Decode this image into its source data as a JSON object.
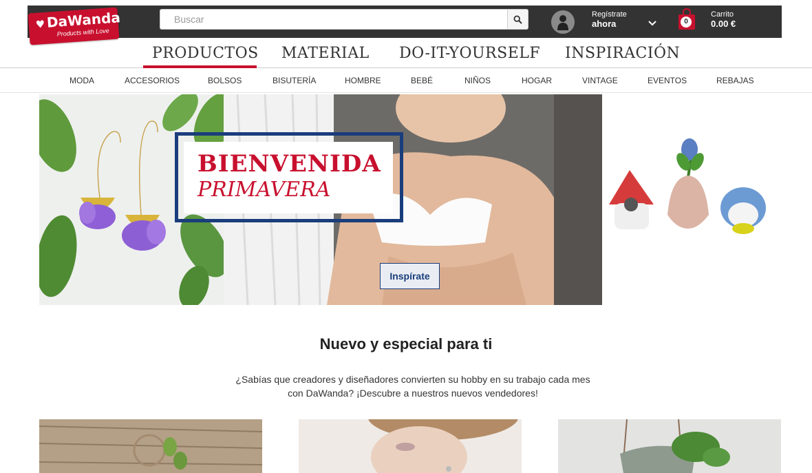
{
  "brand": {
    "name": "DaWanda",
    "tagline": "Products with Love"
  },
  "search": {
    "placeholder": "Buscar"
  },
  "account": {
    "line1": "Regístrate",
    "line2": "ahora"
  },
  "cart": {
    "count": "0",
    "label": "Carrito",
    "total": "0.00 €"
  },
  "main_nav": [
    "PRODUCTOS",
    "MATERIAL",
    "DO-IT-YOURSELF",
    "INSPIRACIÓN"
  ],
  "sub_nav": [
    "MODA",
    "ACCESORIOS",
    "BOLSOS",
    "BISUTERÍA",
    "HOMBRE",
    "BEBÉ",
    "NIÑOS",
    "HOGAR",
    "VINTAGE",
    "EVENTOS",
    "REBAJAS"
  ],
  "hero": {
    "title_line1": "BIENVENIDA",
    "title_line2": "PRIMAVERA",
    "cta": "Inspírate"
  },
  "section": {
    "title": "Nuevo y especial para ti",
    "description": "¿Sabías que creadores y diseñadores convierten su hobby en su trabajo cada mes con DaWanda? ¡Descubre a nuestros nuevos vendedores!"
  },
  "colors": {
    "brand_red": "#c8102e",
    "navy": "#1a3d7c",
    "topbar": "#333333"
  },
  "icons": {
    "search": "magnifier-icon",
    "avatar": "user-avatar-icon",
    "chevron": "chevron-down-icon",
    "cart": "shopping-bag-icon"
  }
}
